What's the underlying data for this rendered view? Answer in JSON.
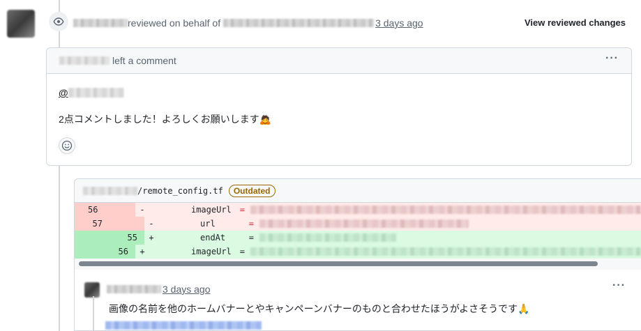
{
  "review": {
    "action_text": "reviewed on behalf of",
    "timestamp": "3 days ago",
    "view_changes_label": "View reviewed changes"
  },
  "comment": {
    "header_suffix": "left a comment",
    "mention_prefix": "@",
    "body": "2点コメントしました！よろしくお願いします🙇",
    "menu_label": "···"
  },
  "file": {
    "path_suffix": "/remote_config.tf",
    "badge": "Outdated"
  },
  "diff": [
    {
      "type": "del",
      "old": "56",
      "new": "",
      "sign": "-",
      "key": "imageUrl",
      "eq": "="
    },
    {
      "type": "del",
      "old": "57",
      "new": "",
      "sign": "-",
      "key": "url     ",
      "eq": "="
    },
    {
      "type": "add",
      "old": "",
      "new": "55",
      "sign": "+",
      "key": "endAt   ",
      "eq": "="
    },
    {
      "type": "add",
      "old": "",
      "new": "56",
      "sign": "+",
      "key": "imageUrl",
      "eq": "="
    }
  ],
  "reply": {
    "timestamp": "3 days ago",
    "body": "画像の名前を他のホームバナーとやキャンペーンバナーのものと合わせたほうがよさそうです🙏",
    "menu_label": "···"
  },
  "colors": {
    "accent": "#0969da",
    "outdated": "#9a6700",
    "del_bg": "#ffebe9",
    "add_bg": "#dafbe1"
  }
}
